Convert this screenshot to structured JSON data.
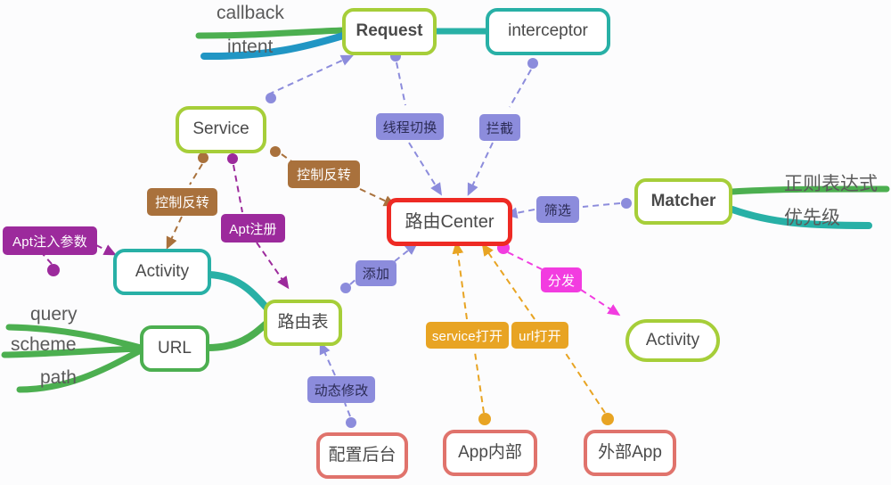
{
  "diagram": {
    "title": "Router architecture mind map",
    "background_color": "#fcfcfd",
    "nodes": {
      "request": {
        "label": "Request",
        "color": "#a6ce39"
      },
      "interceptor": {
        "label": "interceptor",
        "color": "#28b0a6"
      },
      "service": {
        "label": "Service",
        "color": "#a6ce39"
      },
      "activity_left": {
        "label": "Activity",
        "color": "#28b0a6"
      },
      "route_table": {
        "label": "路由表",
        "color": "#a6ce39"
      },
      "url": {
        "label": "URL",
        "color": "#4caf50"
      },
      "router_center": {
        "label": "路由Center",
        "color": "#ee2a24"
      },
      "matcher": {
        "label": "Matcher",
        "color": "#a6ce39"
      },
      "activity_right": {
        "label": "Activity",
        "color": "#a6ce39"
      },
      "config_backend": {
        "label": "配置后台",
        "color": "#e0736c"
      },
      "app_internal": {
        "label": "App内部",
        "color": "#e0736c"
      },
      "app_external": {
        "label": "外部App",
        "color": "#e0736c"
      }
    },
    "branch_labels": {
      "callback": "callback",
      "intent": "intent",
      "query": "query",
      "scheme": "scheme",
      "path": "path",
      "regex": "正则表达式",
      "priority": "优先级"
    },
    "edge_labels": {
      "thread_switch": {
        "text": "线程切换",
        "color": "#8c8cdc"
      },
      "intercept": {
        "text": "拦截",
        "color": "#8c8cdc"
      },
      "filter": {
        "text": "筛选",
        "color": "#8c8cdc"
      },
      "add": {
        "text": "添加",
        "color": "#8c8cdc"
      },
      "dynamic_modify": {
        "text": "动态修改",
        "color": "#8c8cdc"
      },
      "ioc_left": {
        "text": "控制反转",
        "color": "#a9713c"
      },
      "ioc_right": {
        "text": "控制反转",
        "color": "#a9713c"
      },
      "apt_inject": {
        "text": "Apt注入参数",
        "color": "#9c2a9c"
      },
      "apt_register": {
        "text": "Apt注册",
        "color": "#9c2a9c"
      },
      "dispatch": {
        "text": "分发",
        "color": "#f23ce0"
      },
      "service_open": {
        "text": "service打开",
        "color": "#e8a423"
      },
      "url_open": {
        "text": "url打开",
        "color": "#e8a423"
      }
    }
  }
}
